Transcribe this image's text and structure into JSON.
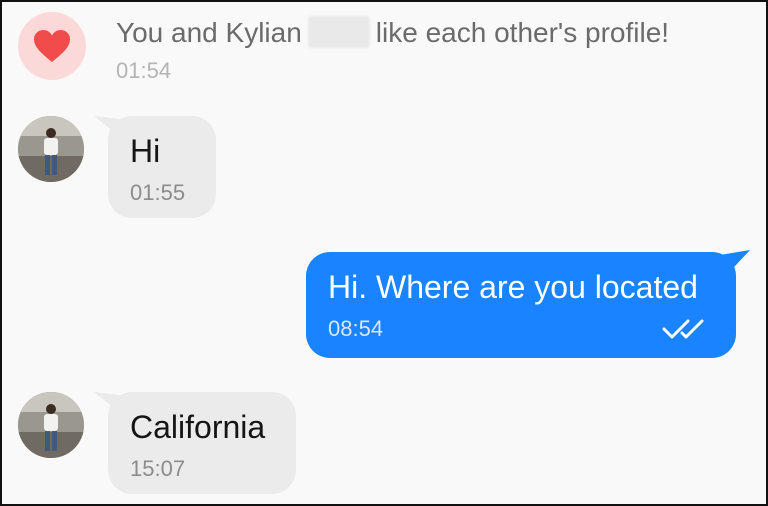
{
  "match": {
    "prefix": "You and Kylian",
    "suffix": "like each other's profile!",
    "time": "01:54",
    "icon": "heart-icon"
  },
  "messages": [
    {
      "direction": "incoming",
      "text": "Hi",
      "time": "01:55"
    },
    {
      "direction": "outgoing",
      "text": "Hi. Where are you located",
      "time": "08:54",
      "status": "read-double-check"
    },
    {
      "direction": "incoming",
      "text": "California",
      "time": "15:07"
    }
  ],
  "colors": {
    "outgoing_bubble": "#1a83ff",
    "incoming_bubble": "#ebebeb",
    "heart": "#f24b4b",
    "heart_circle": "#fcd9d9",
    "background": "#f9f9f9"
  }
}
